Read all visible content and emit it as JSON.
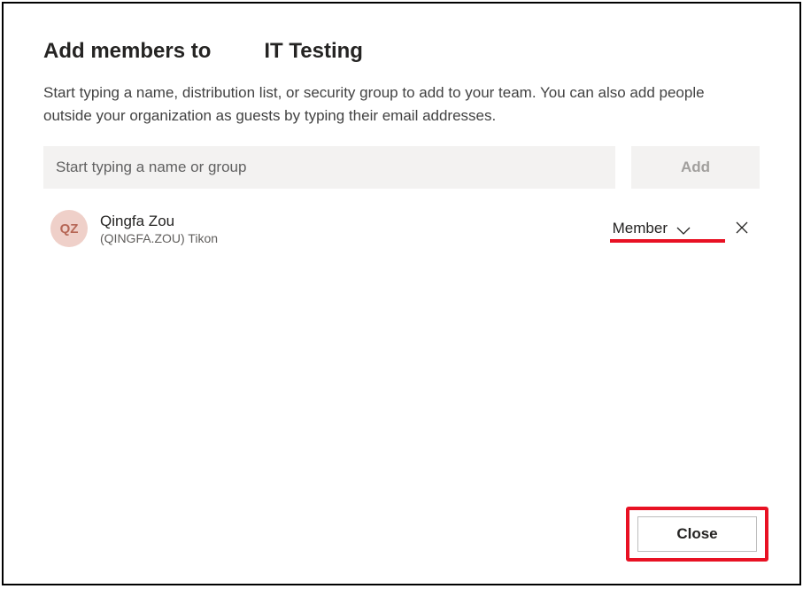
{
  "title": {
    "prefix": "Add members to",
    "team": "IT Testing"
  },
  "description": "Start typing a name, distribution list, or security group to add to your team. You can also add people outside your organization as guests by typing their email addresses.",
  "input": {
    "placeholder": "Start typing a name or group"
  },
  "add_button": "Add",
  "members": [
    {
      "initials": "QZ",
      "name": "Qingfa Zou",
      "sub": "(QINGFA.ZOU) Tikon",
      "role": "Member"
    }
  ],
  "close_button": "Close"
}
